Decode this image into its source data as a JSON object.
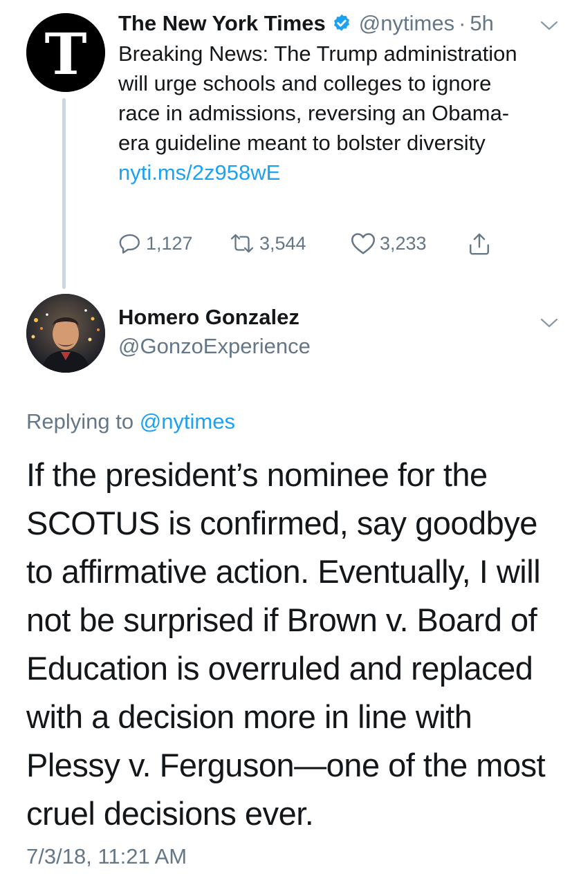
{
  "original_tweet": {
    "author_name": "The New York Times",
    "author_handle": "@nytimes",
    "separator": "·",
    "time_ago": "5h",
    "text": "Breaking News: The Trump administration will urge schools and colleges to ignore race in admissions, reversing an Obama-era guideline meant to bolster diversity ",
    "link": "nyti.ms/2z958wE",
    "replies_count": "1,127",
    "retweets_count": "3,544",
    "likes_count": "3,233",
    "avatar_icon": "nyt-logo-icon",
    "verified_icon": "verified-badge-icon"
  },
  "reply_tweet": {
    "author_name": "Homero Gonzalez",
    "author_handle": "@GonzoExperience",
    "replying_label": "Replying to",
    "replying_to": "@nytimes",
    "text": "If the president’s nominee for the SCOTUS is confirmed, say goodbye to affirmative action. Eventually, I will not be surprised if Brown v. Board of Education is overruled and replaced with a decision more in line with Plessy v. Ferguson—one of the most cruel decisions ever.",
    "timestamp": "7/3/18, 11:21 AM"
  },
  "colors": {
    "text": "#14171a",
    "secondary": "#657786",
    "link": "#1da1f2",
    "thread_line": "#cdd5de"
  }
}
